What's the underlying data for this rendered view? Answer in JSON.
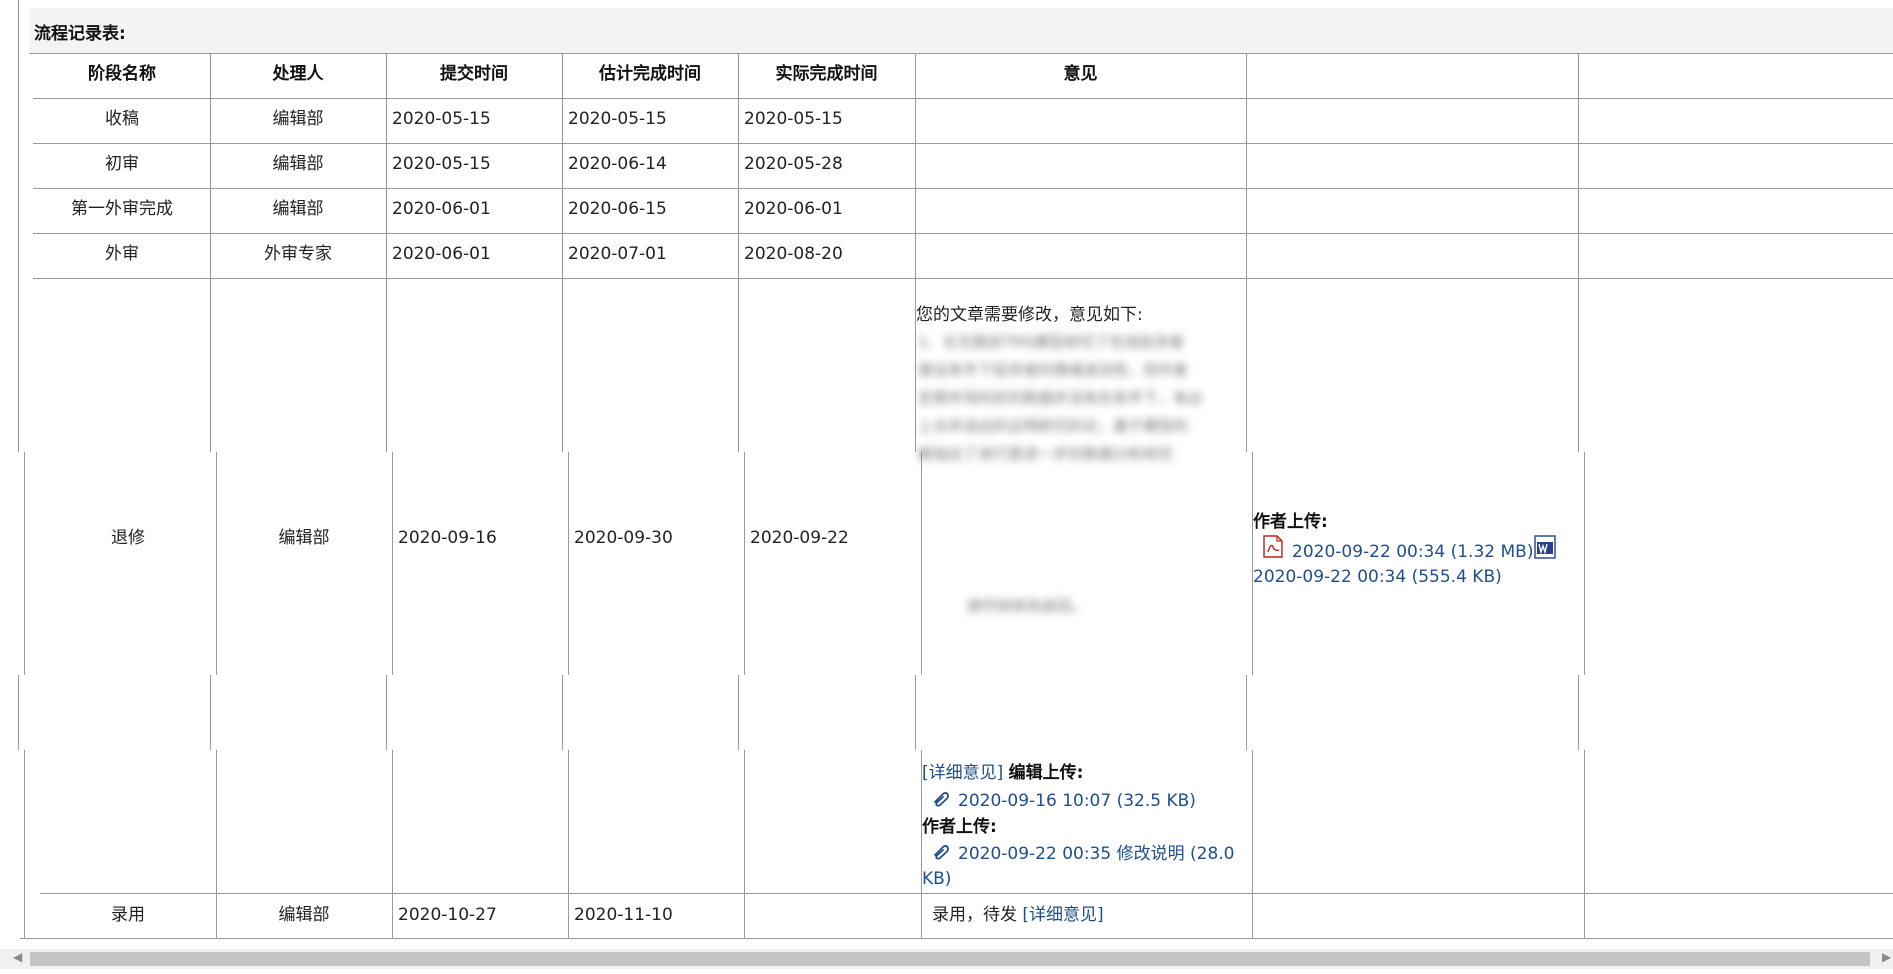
{
  "caption": "流程记录表:",
  "headers": [
    "阶段名称",
    "处理人",
    "提交时间",
    "估计完成时间",
    "实际完成时间",
    "意见"
  ],
  "rows": [
    {
      "stage": "收稿",
      "handler": "编辑部",
      "submit": "2020-05-15",
      "estimate": "2020-05-15",
      "actual": "2020-05-15"
    },
    {
      "stage": "初审",
      "handler": "编辑部",
      "submit": "2020-05-15",
      "estimate": "2020-06-14",
      "actual": "2020-05-28"
    },
    {
      "stage": "第一外审完成",
      "handler": "编辑部",
      "submit": "2020-06-01",
      "estimate": "2020-06-15",
      "actual": "2020-06-01"
    },
    {
      "stage": "外审",
      "handler": "外审专家",
      "submit": "2020-06-01",
      "estimate": "2020-07-01",
      "actual": "2020-08-20"
    },
    {
      "stage": "退修",
      "handler": "编辑部",
      "submit": "2020-09-16",
      "estimate": "2020-09-30",
      "actual": "2020-09-22"
    },
    {
      "stage": "录用",
      "handler": "编辑部",
      "submit": "2020-10-27",
      "estimate": "2020-11-10",
      "actual": ""
    }
  ],
  "revise": {
    "opinion_intro": "您的文章需要修改，意见如下:",
    "opinion_blurred_lines": [
      "1、论文题目TMS模型研究了在线投资者",
      "建设条件下投资者的情绪波动性，但作者",
      "定期市场利好的数据并没有在条件下，有必",
      "上合并选出的证明研究的论，基于模型的",
      "都指出了进行更进一步的数据分析研究"
    ],
    "opinion_blurred_tail": "请尽快修改返回。",
    "author_upload_label": "作者上传:",
    "author_file_1": "2020-09-22 00:34 (1.32 MB)",
    "author_file_2": "2020-09-22 00:34 (555.4 KB)",
    "detail_link": "[详细意见]",
    "editor_upload_label": "编辑上传:",
    "editor_file": "2020-09-16 10:07 (32.5 KB)",
    "author_upload_label_2": "作者上传:",
    "author_file_3_line1": "2020-09-22 00:35 修改说明 (28.0",
    "author_file_3_line2": "KB)"
  },
  "accept": {
    "opinion_text": "录用，待发",
    "detail_link": "[详细意见]"
  },
  "colors": {
    "link": "#1f4e8c",
    "border": "#9a9a9a",
    "header_bg": "#f4f4f4"
  },
  "icons": [
    "pdf-icon",
    "word-icon",
    "paperclip-icon"
  ]
}
